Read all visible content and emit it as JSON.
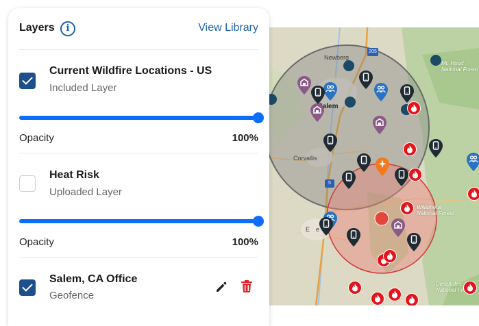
{
  "panel": {
    "title": "Layers",
    "view_library_label": "View Library",
    "layers": [
      {
        "name": "Current Wildfire Locations - US",
        "type": "Included Layer",
        "checked": true,
        "opacity_label": "Opacity",
        "opacity_value": "100%",
        "opacity": 1.0
      },
      {
        "name": "Heat Risk",
        "type": "Uploaded Layer",
        "checked": false,
        "opacity_label": "Opacity",
        "opacity_value": "100%",
        "opacity": 1.0
      },
      {
        "name": "Salem, CA Office",
        "type": "Geofence",
        "checked": true
      }
    ]
  },
  "map": {
    "labels": {
      "newberg": "Newberg",
      "salem": "Salem",
      "corvallis": "Corvallis",
      "eugene_e": "E",
      "eugene_e2": "e",
      "mthood": "Mt. Hood",
      "mthood_nf": "National Forest",
      "willamette": "Willamette",
      "willamette_nf": "National Forest",
      "deschutes": "Deschutes",
      "deschutes_nf": "National Forest",
      "hwy_205": "205",
      "hwy_5": "5"
    },
    "colors": {
      "heat_circle": "#e8827a",
      "geofence_circle": "#7d7d7d",
      "fire": "#e4141b",
      "device": "#1f2a33",
      "people": "#2a73c2",
      "office": "#8a5a86",
      "alert": "#f07a1c",
      "dot": "#1b4a66"
    }
  }
}
